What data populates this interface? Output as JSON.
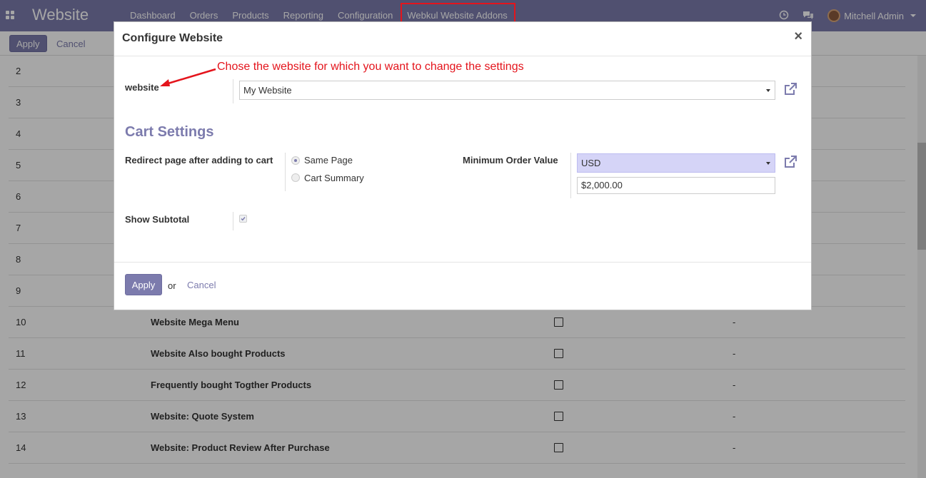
{
  "navbar": {
    "brand": "Website",
    "menu": [
      "Dashboard",
      "Orders",
      "Products",
      "Reporting",
      "Configuration",
      "Webkul Website Addons"
    ],
    "user_name": "Mitchell Admin"
  },
  "control_panel": {
    "apply_label": "Apply",
    "cancel_label": "Cancel"
  },
  "list": {
    "rows": [
      {
        "num": "2",
        "name": "",
        "checked": false,
        "dash": ""
      },
      {
        "num": "3",
        "name": "",
        "checked": false,
        "dash": ""
      },
      {
        "num": "4",
        "name": "",
        "checked": false,
        "dash": ""
      },
      {
        "num": "5",
        "name": "",
        "checked": false,
        "dash": ""
      },
      {
        "num": "6",
        "name": "",
        "checked": false,
        "dash": ""
      },
      {
        "num": "7",
        "name": "",
        "checked": false,
        "dash": ""
      },
      {
        "num": "8",
        "name": "",
        "checked": false,
        "dash": ""
      },
      {
        "num": "9",
        "name": "",
        "checked": false,
        "dash": ""
      },
      {
        "num": "10",
        "name": "Website Mega Menu",
        "checked": false,
        "dash": "-"
      },
      {
        "num": "11",
        "name": "Website Also bought Products",
        "checked": false,
        "dash": "-"
      },
      {
        "num": "12",
        "name": "Frequently bought Togther Products",
        "checked": false,
        "dash": "-"
      },
      {
        "num": "13",
        "name": "Website: Quote System",
        "checked": false,
        "dash": "-"
      },
      {
        "num": "14",
        "name": "Website: Product Review After Purchase",
        "checked": false,
        "dash": "-"
      }
    ]
  },
  "modal": {
    "title": "Configure Website",
    "close": "×",
    "annotation": "Chose the website for which you want to change the settings",
    "website_label": "website",
    "website_value": "My Website",
    "section_title": "Cart Settings",
    "redirect_label": "Redirect page after adding to cart",
    "redirect_options": [
      "Same Page",
      "Cart Summary"
    ],
    "redirect_selected": "Same Page",
    "min_order_label": "Minimum Order Value",
    "currency_value": "USD",
    "min_order_amount": "$2,000.00",
    "subtotal_label": "Show Subtotal",
    "subtotal_checked": true,
    "footer": {
      "apply": "Apply",
      "or": "or",
      "cancel": "Cancel"
    }
  },
  "colors": {
    "primary": "#7c7bad",
    "annotation": "#e4141c",
    "currency_bg": "#d5d4f7"
  }
}
